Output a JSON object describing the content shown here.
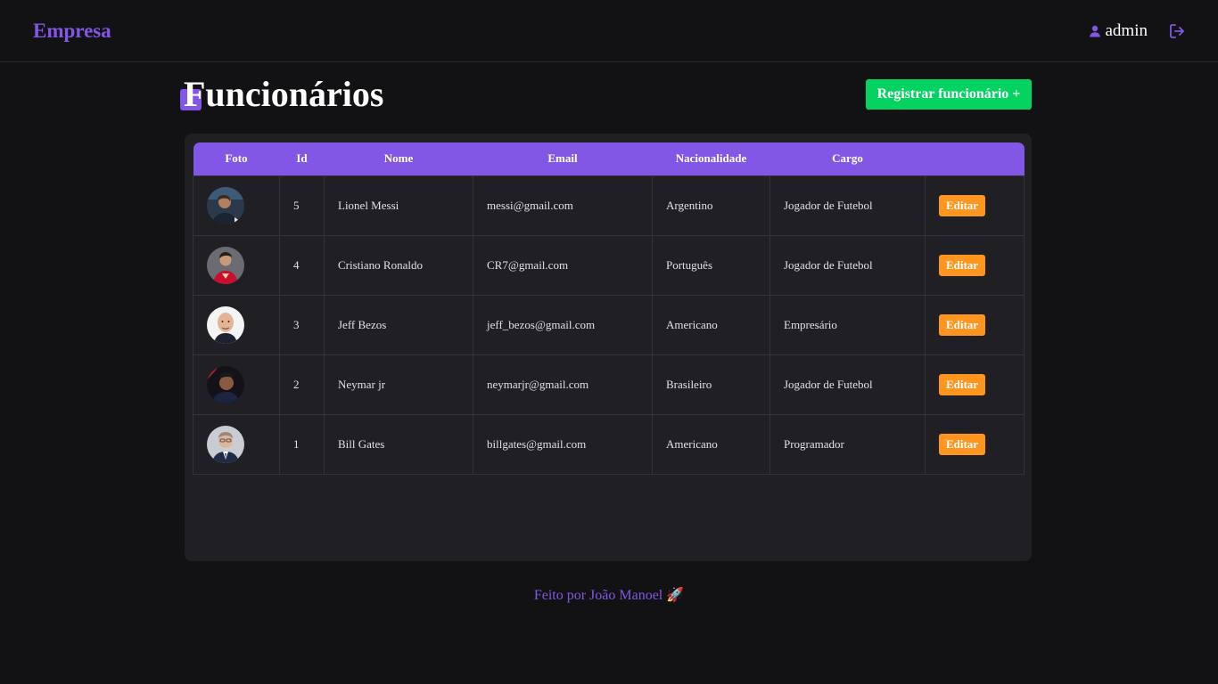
{
  "navbar": {
    "brand": "Empresa",
    "username": "admin",
    "user_icon": "user-icon",
    "logout_icon": "logout-icon"
  },
  "header": {
    "title": "Funcionários",
    "register_label": "Registrar funcionário +"
  },
  "table": {
    "columns": [
      "Foto",
      "Id",
      "Nome",
      "Email",
      "Nacionalidade",
      "Cargo",
      ""
    ],
    "edit_label": "Editar",
    "rows": [
      {
        "id": "5",
        "name": "Lionel Messi",
        "email": "messi@gmail.com",
        "nationality": "Argentino",
        "role": "Jogador de Futebol"
      },
      {
        "id": "4",
        "name": "Cristiano Ronaldo",
        "email": "CR7@gmail.com",
        "nationality": "Português",
        "role": "Jogador de Futebol"
      },
      {
        "id": "3",
        "name": "Jeff Bezos",
        "email": "jeff_bezos@gmail.com",
        "nationality": "Americano",
        "role": "Empresário"
      },
      {
        "id": "2",
        "name": "Neymar jr",
        "email": "neymarjr@gmail.com",
        "nationality": "Brasileiro",
        "role": "Jogador de Futebol"
      },
      {
        "id": "1",
        "name": "Bill Gates",
        "email": "billgates@gmail.com",
        "nationality": "Americano",
        "role": "Programador"
      }
    ]
  },
  "footer": {
    "text": "Feito por João Manoel 🚀"
  },
  "colors": {
    "accent": "#8257e5",
    "success": "#04d361",
    "warning": "#fd951f",
    "background": "#121214",
    "card": "#202024"
  }
}
